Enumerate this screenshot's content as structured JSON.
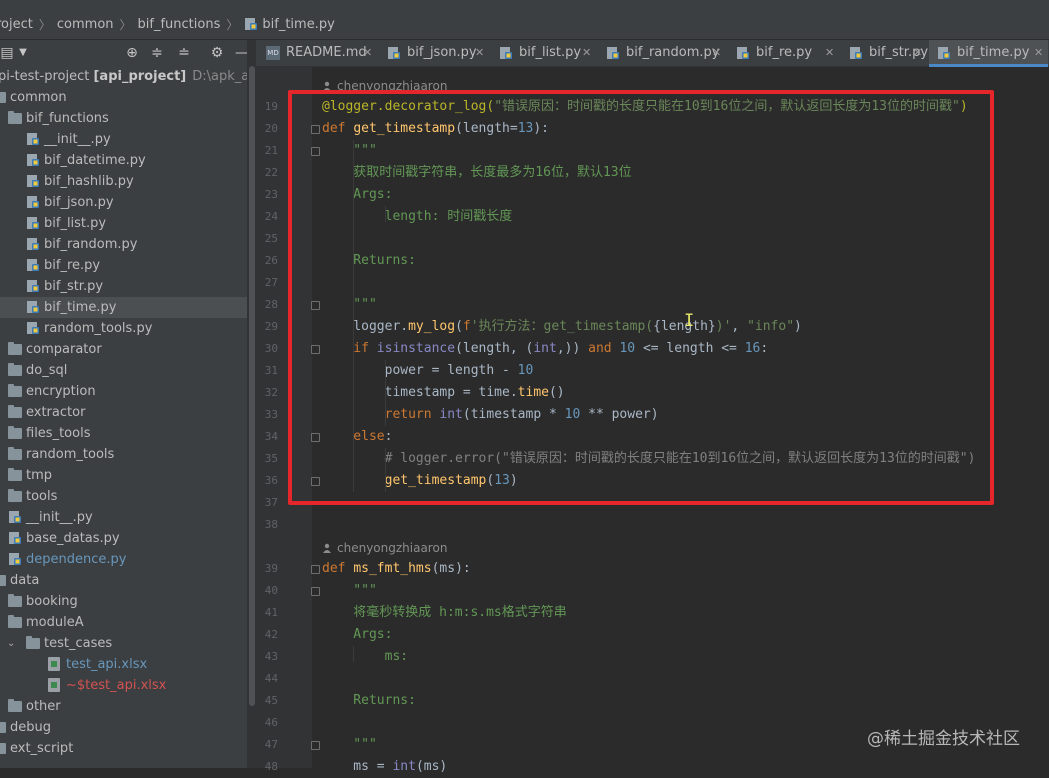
{
  "breadcrumb": {
    "items": [
      "roject",
      "common",
      "bif_functions",
      "bif_time.py"
    ]
  },
  "colors": {
    "keyword": "#cc7832",
    "function": "#ffc66d",
    "string": "#6a8759",
    "number": "#6897bb",
    "docstring": "#629755",
    "decorator": "#bbb529",
    "comment": "#808080",
    "highlight_box": "#e5262b",
    "active_tab_underline": "#4a88c7"
  },
  "project": {
    "root_label": "pi-test-project",
    "root_module": "[api_project]",
    "root_path": "D:\\apk_api\\api-",
    "tree": [
      {
        "label": "common",
        "type": "folder",
        "indent": 0
      },
      {
        "label": "bif_functions",
        "type": "folder",
        "indent": 1
      },
      {
        "label": "__init__.py",
        "type": "py",
        "indent": 2
      },
      {
        "label": "bif_datetime.py",
        "type": "py",
        "indent": 2
      },
      {
        "label": "bif_hashlib.py",
        "type": "py",
        "indent": 2
      },
      {
        "label": "bif_json.py",
        "type": "py",
        "indent": 2
      },
      {
        "label": "bif_list.py",
        "type": "py",
        "indent": 2
      },
      {
        "label": "bif_random.py",
        "type": "py",
        "indent": 2
      },
      {
        "label": "bif_re.py",
        "type": "py",
        "indent": 2
      },
      {
        "label": "bif_str.py",
        "type": "py",
        "indent": 2
      },
      {
        "label": "bif_time.py",
        "type": "py",
        "indent": 2,
        "selected": true
      },
      {
        "label": "random_tools.py",
        "type": "py",
        "indent": 2
      },
      {
        "label": "comparator",
        "type": "folder",
        "indent": 1
      },
      {
        "label": "do_sql",
        "type": "folder",
        "indent": 1
      },
      {
        "label": "encryption",
        "type": "folder",
        "indent": 1
      },
      {
        "label": "extractor",
        "type": "folder",
        "indent": 1
      },
      {
        "label": "files_tools",
        "type": "folder",
        "indent": 1
      },
      {
        "label": "random_tools",
        "type": "folder",
        "indent": 1
      },
      {
        "label": "tmp",
        "type": "folder",
        "indent": 1
      },
      {
        "label": "tools",
        "type": "folder",
        "indent": 1
      },
      {
        "label": "__init__.py",
        "type": "py",
        "indent": 1
      },
      {
        "label": "base_datas.py",
        "type": "py",
        "indent": 1
      },
      {
        "label": "dependence.py",
        "type": "py",
        "indent": 1,
        "color": "#6897bb"
      },
      {
        "label": "data",
        "type": "folder",
        "indent": 0
      },
      {
        "label": "booking",
        "type": "folder",
        "indent": 1
      },
      {
        "label": "moduleA",
        "type": "folder",
        "indent": 1
      },
      {
        "label": "test_cases",
        "type": "folder",
        "indent": 1,
        "expanded": true
      },
      {
        "label": "test_api.xlsx",
        "type": "xls",
        "indent": 2,
        "color": "#6897bb"
      },
      {
        "label": "~$test_api.xlsx",
        "type": "xls",
        "indent": 2,
        "color": "#d25252"
      },
      {
        "label": "other",
        "type": "folder",
        "indent": 1
      },
      {
        "label": "debug",
        "type": "folder",
        "indent": 0
      },
      {
        "label": "ext_script",
        "type": "folder",
        "indent": 0
      }
    ]
  },
  "tabs": [
    {
      "label": "README.md",
      "icon": "markdown-icon"
    },
    {
      "label": "bif_json.py",
      "icon": "python-file-icon"
    },
    {
      "label": "bif_list.py",
      "icon": "python-file-icon"
    },
    {
      "label": "bif_random.py",
      "icon": "python-file-icon"
    },
    {
      "label": "bif_re.py",
      "icon": "python-file-icon"
    },
    {
      "label": "bif_str.py",
      "icon": "python-file-icon"
    },
    {
      "label": "bif_time.py",
      "icon": "python-file-icon",
      "active": true
    }
  ],
  "editor": {
    "authors": [
      "chenyongzhiaaron",
      "chenyongzhiaaron"
    ],
    "lines": [
      {
        "n": "19",
        "tokens": [
          [
            "deco",
            "@logger.decorator_log("
          ],
          [
            "str",
            "\"错误原因：时间戳的长度只能在10到16位之间，默认返回长度为13位的时间戳\""
          ],
          [
            "deco",
            ")"
          ]
        ]
      },
      {
        "n": "20",
        "tokens": [
          [
            "kw",
            "def "
          ],
          [
            "fn",
            "get_timestamp"
          ],
          [
            "plain",
            "(length="
          ],
          [
            "num",
            "13"
          ],
          [
            "plain",
            "):"
          ]
        ]
      },
      {
        "n": "21",
        "tokens": [
          [
            "doc",
            "    \"\"\""
          ]
        ]
      },
      {
        "n": "22",
        "tokens": [
          [
            "doc",
            "    获取时间戳字符串，长度最多为16位，默认13位"
          ]
        ]
      },
      {
        "n": "23",
        "tokens": [
          [
            "doc",
            "    Args:"
          ]
        ]
      },
      {
        "n": "24",
        "tokens": [
          [
            "doc",
            "        length: 时间戳长度"
          ]
        ]
      },
      {
        "n": "25",
        "tokens": []
      },
      {
        "n": "26",
        "tokens": [
          [
            "doc",
            "    Returns:"
          ]
        ]
      },
      {
        "n": "27",
        "tokens": []
      },
      {
        "n": "28",
        "tokens": [
          [
            "doc",
            "    \"\"\""
          ]
        ]
      },
      {
        "n": "29",
        "tokens": [
          [
            "plain",
            "    logger."
          ],
          [
            "fn",
            "my_log"
          ],
          [
            "plain",
            "("
          ],
          [
            "kw",
            "f"
          ],
          [
            "str",
            "'执行方法：get_timestamp("
          ],
          [
            "plain",
            "{length}"
          ],
          [
            "str",
            ")'"
          ],
          [
            "plain",
            ", "
          ],
          [
            "str",
            "\"info\""
          ],
          [
            "plain",
            ")"
          ]
        ]
      },
      {
        "n": "30",
        "tokens": [
          [
            "kw",
            "    if "
          ],
          [
            "bi",
            "isinstance"
          ],
          [
            "plain",
            "(length, ("
          ],
          [
            "bi",
            "int"
          ],
          [
            "plain",
            ",)) "
          ],
          [
            "kw",
            "and "
          ],
          [
            "num",
            "10"
          ],
          [
            "plain",
            " <= length <= "
          ],
          [
            "num",
            "16"
          ],
          [
            "plain",
            ":"
          ]
        ]
      },
      {
        "n": "31",
        "tokens": [
          [
            "plain",
            "        power = length - "
          ],
          [
            "num",
            "10"
          ]
        ]
      },
      {
        "n": "32",
        "tokens": [
          [
            "plain",
            "        timestamp = time."
          ],
          [
            "fn",
            "time"
          ],
          [
            "plain",
            "()"
          ]
        ]
      },
      {
        "n": "33",
        "tokens": [
          [
            "kw",
            "        return "
          ],
          [
            "bi",
            "int"
          ],
          [
            "plain",
            "(timestamp * "
          ],
          [
            "num",
            "10"
          ],
          [
            "plain",
            " ** power)"
          ]
        ]
      },
      {
        "n": "34",
        "tokens": [
          [
            "kw",
            "    else"
          ],
          [
            "plain",
            ":"
          ]
        ]
      },
      {
        "n": "35",
        "tokens": [
          [
            "cmt",
            "        # logger.error(\"错误原因：时间戳的长度只能在10到16位之间，默认返回长度为13位的时间戳\")"
          ]
        ]
      },
      {
        "n": "36",
        "tokens": [
          [
            "plain",
            "        "
          ],
          [
            "fn",
            "get_timestamp"
          ],
          [
            "plain",
            "("
          ],
          [
            "num",
            "13"
          ],
          [
            "plain",
            ")"
          ]
        ]
      },
      {
        "n": "37",
        "tokens": []
      },
      {
        "n": "38",
        "tokens": []
      },
      {
        "n": "39",
        "tokens": [
          [
            "kw",
            "def "
          ],
          [
            "fn",
            "ms_fmt_hms"
          ],
          [
            "plain",
            "(ms):"
          ]
        ]
      },
      {
        "n": "40",
        "tokens": [
          [
            "doc",
            "    \"\"\""
          ]
        ]
      },
      {
        "n": "41",
        "tokens": [
          [
            "doc",
            "    将毫秒转换成 h:m:s.ms格式字符串"
          ]
        ]
      },
      {
        "n": "42",
        "tokens": [
          [
            "doc",
            "    Args:"
          ]
        ]
      },
      {
        "n": "43",
        "tokens": [
          [
            "doc",
            "        ms:"
          ]
        ]
      },
      {
        "n": "44",
        "tokens": []
      },
      {
        "n": "45",
        "tokens": [
          [
            "doc",
            "    Returns:"
          ]
        ]
      },
      {
        "n": "46",
        "tokens": []
      },
      {
        "n": "47",
        "tokens": [
          [
            "doc",
            "    \"\"\""
          ]
        ]
      },
      {
        "n": "48",
        "tokens": [
          [
            "plain",
            "    ms = "
          ],
          [
            "bi",
            "int"
          ],
          [
            "plain",
            "(ms)"
          ]
        ]
      }
    ]
  },
  "watermark": "@稀土掘金技术社区"
}
